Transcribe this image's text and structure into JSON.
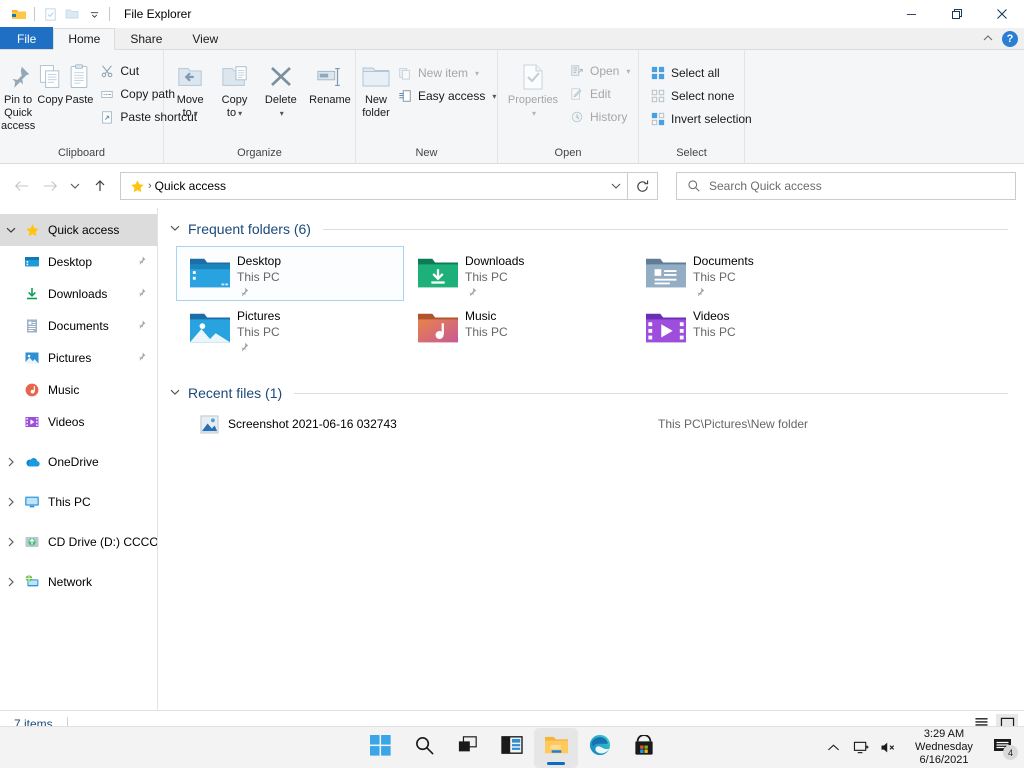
{
  "window": {
    "title": "File Explorer",
    "quick_access_toolbar": [
      {
        "name": "folder-icon",
        "label": "Restore Down / properties"
      },
      {
        "name": "properties-icon",
        "label": "Properties"
      },
      {
        "name": "new-folder-icon",
        "label": "New folder"
      },
      {
        "name": "chevron-down-icon",
        "label": "Customize Quick Access Toolbar"
      }
    ],
    "controls": {
      "minimize": "—",
      "maximize": "❐",
      "close": "✕"
    }
  },
  "ribbon": {
    "tabs": [
      {
        "label": "File",
        "kind": "file"
      },
      {
        "label": "Home",
        "kind": "active"
      },
      {
        "label": "Share",
        "kind": "normal"
      },
      {
        "label": "View",
        "kind": "normal"
      }
    ],
    "collapse_label": "⌃",
    "help_label": "?",
    "groups": [
      {
        "name": "Clipboard",
        "big": [
          {
            "label": "Pin to Quick\naccess",
            "line1": "Pin to Quick",
            "line2": "access",
            "icon": "pin-icon",
            "disabled": false
          },
          {
            "label": "Copy",
            "line1": "Copy",
            "line2": "",
            "icon": "copy-icon",
            "disabled": false
          },
          {
            "label": "Paste",
            "line1": "Paste",
            "line2": "",
            "icon": "paste-icon",
            "disabled": false
          }
        ],
        "small": [
          {
            "label": "Cut",
            "icon": "scissors-icon",
            "disabled": false,
            "caret": false
          },
          {
            "label": "Copy path",
            "icon": "copy-path-icon",
            "disabled": false,
            "caret": false
          },
          {
            "label": "Paste shortcut",
            "icon": "paste-shortcut-icon",
            "disabled": false,
            "caret": false
          }
        ]
      },
      {
        "name": "Organize",
        "big": [
          {
            "line1": "Move",
            "line2": "to",
            "icon": "move-to-icon",
            "disabled": false,
            "caret": true
          },
          {
            "line1": "Copy",
            "line2": "to",
            "icon": "copy-to-icon",
            "disabled": false,
            "caret": true
          },
          {
            "line1": "Delete",
            "line2": "",
            "icon": "delete-icon",
            "disabled": false,
            "caret": true
          },
          {
            "line1": "Rename",
            "line2": "",
            "icon": "rename-icon",
            "disabled": false,
            "caret": false
          }
        ],
        "small": []
      },
      {
        "name": "New",
        "big": [
          {
            "line1": "New",
            "line2": "folder",
            "icon": "new-folder-icon",
            "disabled": false,
            "caret": false
          }
        ],
        "small": [
          {
            "label": "New item",
            "icon": "new-item-icon",
            "disabled": true,
            "caret": true
          },
          {
            "label": "Easy access",
            "icon": "easy-access-icon",
            "disabled": true,
            "caret": true
          }
        ]
      },
      {
        "name": "Open",
        "big": [
          {
            "line1": "Properties",
            "line2": "",
            "icon": "properties-icon",
            "disabled": true,
            "caret": true
          }
        ],
        "small": [
          {
            "label": "Open",
            "icon": "open-icon",
            "disabled": true,
            "caret": true
          },
          {
            "label": "Edit",
            "icon": "edit-icon",
            "disabled": true,
            "caret": false
          },
          {
            "label": "History",
            "icon": "history-icon",
            "disabled": true,
            "caret": false
          }
        ]
      },
      {
        "name": "Select",
        "big": [],
        "small": [
          {
            "label": "Select all",
            "icon": "select-all-icon",
            "disabled": false,
            "caret": false
          },
          {
            "label": "Select none",
            "icon": "select-none-icon",
            "disabled": false,
            "caret": false
          },
          {
            "label": "Invert selection",
            "icon": "invert-selection-icon",
            "disabled": false,
            "caret": false
          }
        ]
      }
    ]
  },
  "navbar": {
    "back_icon": "back-arrow-icon",
    "forward_icon": "forward-arrow-icon",
    "recent_icon": "chevron-down-icon",
    "up_icon": "up-arrow-icon",
    "address": {
      "icon": "star-icon",
      "separator": "›",
      "crumb": "Quick access",
      "dropdown_icon": "chevron-down-icon"
    },
    "refresh_icon": "refresh-icon",
    "search": {
      "icon": "search-icon",
      "placeholder": "Search Quick access",
      "value": ""
    }
  },
  "sidebar": {
    "items": [
      {
        "label": "Quick access",
        "icon": "star-icon",
        "indent": 0,
        "chevron": "expanded",
        "selected": true,
        "pinned": false
      },
      {
        "label": "Desktop",
        "icon": "desktop-icon",
        "indent": 1,
        "chevron": "none",
        "selected": false,
        "pinned": true
      },
      {
        "label": "Downloads",
        "icon": "downloads-icon",
        "indent": 1,
        "chevron": "none",
        "selected": false,
        "pinned": true
      },
      {
        "label": "Documents",
        "icon": "documents-icon",
        "indent": 1,
        "chevron": "none",
        "selected": false,
        "pinned": true
      },
      {
        "label": "Pictures",
        "icon": "pictures-icon",
        "indent": 1,
        "chevron": "none",
        "selected": false,
        "pinned": true
      },
      {
        "label": "Music",
        "icon": "music-icon",
        "indent": 1,
        "chevron": "none",
        "selected": false,
        "pinned": false
      },
      {
        "label": "Videos",
        "icon": "videos-icon",
        "indent": 1,
        "chevron": "none",
        "selected": false,
        "pinned": false
      },
      {
        "label": "OneDrive",
        "icon": "onedrive-icon",
        "indent": 0,
        "chevron": "collapsed",
        "selected": false,
        "pinned": false
      },
      {
        "label": "This PC",
        "icon": "this-pc-icon",
        "indent": 0,
        "chevron": "collapsed",
        "selected": false,
        "pinned": false
      },
      {
        "label": "CD Drive (D:) CCCOM",
        "icon": "cd-drive-icon",
        "indent": 0,
        "chevron": "collapsed",
        "selected": false,
        "pinned": false
      },
      {
        "label": "Network",
        "icon": "network-icon",
        "indent": 0,
        "chevron": "collapsed",
        "selected": false,
        "pinned": false
      }
    ]
  },
  "content": {
    "sections": [
      {
        "title": "Frequent folders (6)",
        "collapse_icon": "chevron-down-icon"
      },
      {
        "title": "Recent files (1)",
        "collapse_icon": "chevron-down-icon"
      }
    ],
    "frequent_folders": [
      {
        "name": "Desktop",
        "location": "This PC",
        "icon": "desktop-folder-icon",
        "pinned": true,
        "selected": true
      },
      {
        "name": "Downloads",
        "location": "This PC",
        "icon": "downloads-folder-icon",
        "pinned": true,
        "selected": false
      },
      {
        "name": "Documents",
        "location": "This PC",
        "icon": "documents-folder-icon",
        "pinned": true,
        "selected": false
      },
      {
        "name": "Pictures",
        "location": "This PC",
        "icon": "pictures-folder-icon",
        "pinned": true,
        "selected": false
      },
      {
        "name": "Music",
        "location": "This PC",
        "icon": "music-folder-icon",
        "pinned": false,
        "selected": false
      },
      {
        "name": "Videos",
        "location": "This PC",
        "icon": "videos-folder-icon",
        "pinned": false,
        "selected": false
      }
    ],
    "recent_files": [
      {
        "name": "Screenshot 2021-06-16 032743",
        "path": "This PC\\Pictures\\New folder",
        "icon": "image-file-icon"
      }
    ]
  },
  "statusbar": {
    "item_count": "7 items",
    "views": [
      {
        "name": "details-view-button",
        "icon": "list-lines-icon",
        "selected": false
      },
      {
        "name": "large-icons-view-button",
        "icon": "tile-square-icon",
        "selected": true
      }
    ]
  },
  "taskbar": {
    "apps": [
      {
        "name": "start-button",
        "icon": "windows-logo-icon",
        "active": false
      },
      {
        "name": "search-taskbar-button",
        "icon": "search-icon",
        "active": false
      },
      {
        "name": "task-view-button",
        "icon": "task-view-icon",
        "active": false
      },
      {
        "name": "widgets-button",
        "icon": "widgets-icon",
        "active": false
      },
      {
        "name": "file-explorer-button",
        "icon": "file-explorer-icon",
        "active": true
      },
      {
        "name": "edge-button",
        "icon": "edge-icon",
        "active": false
      },
      {
        "name": "microsoft-store-button",
        "icon": "store-icon",
        "active": false
      }
    ],
    "tray": {
      "overflow_icon": "chevron-up-icon",
      "network_icon": "network-tray-icon",
      "volume_icon": "volume-muted-icon",
      "clock": {
        "time": "3:29 AM",
        "weekday": "Wednesday",
        "date": "6/16/2021"
      },
      "notifications": {
        "icon": "notification-icon",
        "count": "4"
      }
    }
  }
}
